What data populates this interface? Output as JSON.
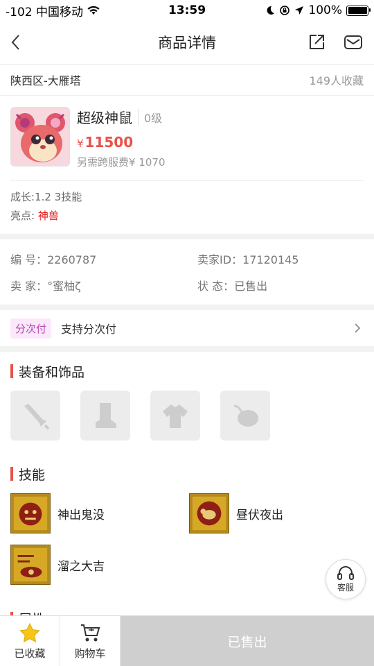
{
  "status_bar": {
    "carrier": "-102 中国移动",
    "time": "13:59",
    "battery": "100%"
  },
  "nav": {
    "title": "商品详情"
  },
  "location": {
    "server": "陕西区-大雁塔",
    "favorites": "149人收藏"
  },
  "product": {
    "name": "超级神鼠",
    "level": "0级",
    "currency": "¥",
    "price": "11500",
    "fee": "另需跨服费¥ 1070"
  },
  "attributes": {
    "growth": "成长:1.2 3技能",
    "highlight_label": "亮点:",
    "highlight_value": "神兽"
  },
  "meta": {
    "id_label": "编 号：2260787",
    "seller_id_label": "卖家ID：17120145",
    "seller_label": "卖 家：°蜜柚ζ",
    "status_label": "状 态：已售出"
  },
  "installment": {
    "tag": "分次付",
    "text": "支持分次付"
  },
  "equipment": {
    "title": "装备和饰品",
    "slots": [
      "sword-icon",
      "boot-icon",
      "armor-icon",
      "accessory-icon"
    ]
  },
  "skills": {
    "title": "技能",
    "items": [
      {
        "name": "神出鬼没"
      },
      {
        "name": "昼伏夜出"
      },
      {
        "name": "溜之大吉"
      }
    ]
  },
  "next_section": {
    "title": "属性"
  },
  "service": {
    "label": "客服"
  },
  "bottom": {
    "favorited": "已收藏",
    "cart": "购物车",
    "sold": "已售出"
  },
  "colors": {
    "accent": "#e8524b",
    "highlight": "#e21b1b",
    "tag_bg": "#fbe8fb",
    "tag_fg": "#b548b5",
    "sold_bg": "#cfcfcf",
    "star": "#f5c518"
  }
}
